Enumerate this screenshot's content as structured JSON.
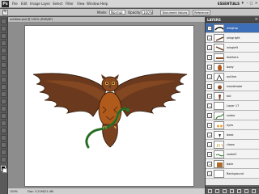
{
  "menubar": {
    "app_logo": "Ps",
    "items": [
      "File",
      "Edit",
      "Image",
      "Layer",
      "Select",
      "Filter",
      "View",
      "Window",
      "Help"
    ],
    "workspace": "ESSENTIALS"
  },
  "options": {
    "mode_label": "Mode:",
    "mode_value": "Normal",
    "opacity_label": "Opacity:",
    "opacity_value": "100%",
    "document_button": "Document Values",
    "reference_button": "Reference"
  },
  "document": {
    "tab_label": "untitled.psd @ 100% (RGB/8*)",
    "zoom": "100%",
    "doc_info": "Doc: 3.21M/21.4M"
  },
  "layers": {
    "tab": "LAYERS",
    "items": [
      {
        "name": "wingtop",
        "selected": true
      },
      {
        "name": "wingright",
        "selected": false
      },
      {
        "name": "wingleft",
        "selected": false
      },
      {
        "name": "feathers",
        "selected": false
      },
      {
        "name": "body",
        "selected": false
      },
      {
        "name": "outline",
        "selected": false
      },
      {
        "name": "headshade",
        "selected": false
      },
      {
        "name": "tail",
        "selected": false
      },
      {
        "name": "Layer 17",
        "selected": false
      },
      {
        "name": "snake",
        "selected": false
      },
      {
        "name": "eyes",
        "selected": false
      },
      {
        "name": "beak",
        "selected": false
      },
      {
        "name": "claws",
        "selected": false
      },
      {
        "name": "snake2",
        "selected": false
      },
      {
        "name": "back",
        "selected": false
      },
      {
        "name": "Background",
        "selected": false
      }
    ]
  },
  "colors": {
    "accent": "#3d6fb8",
    "owl_brown": "#6b3a1e",
    "owl_orange": "#b05a1c",
    "snake_green": "#2f7a2a"
  }
}
